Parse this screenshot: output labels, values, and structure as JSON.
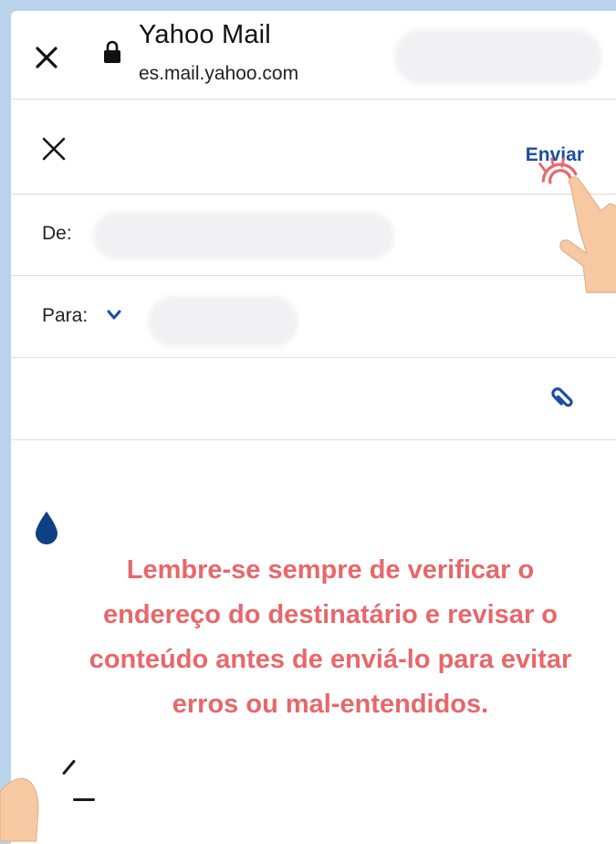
{
  "browser": {
    "title": "Yahoo Mail",
    "url": "es.mail.yahoo.com",
    "close_icon": "close-icon",
    "lock_icon": "lock-icon"
  },
  "compose": {
    "close_icon": "close-icon",
    "send_label": "Enviar",
    "from_label": "De:",
    "to_label": "Para:",
    "to_expand_icon": "chevron-down-icon",
    "attach_icon": "paperclip-icon"
  },
  "tip": {
    "text": "Lembre-se sempre de verificar o endereço do destinatário e revisar o conteúdo antes de enviá-lo para evitar erros ou mal-entendidos."
  },
  "colors": {
    "background": "#b8d3ea",
    "accent_blue": "#1a4fa0",
    "tip_text": "#e8676a",
    "drop": "#0f3f85",
    "hand": "#f6c9a3",
    "tap": "#e8676a"
  }
}
